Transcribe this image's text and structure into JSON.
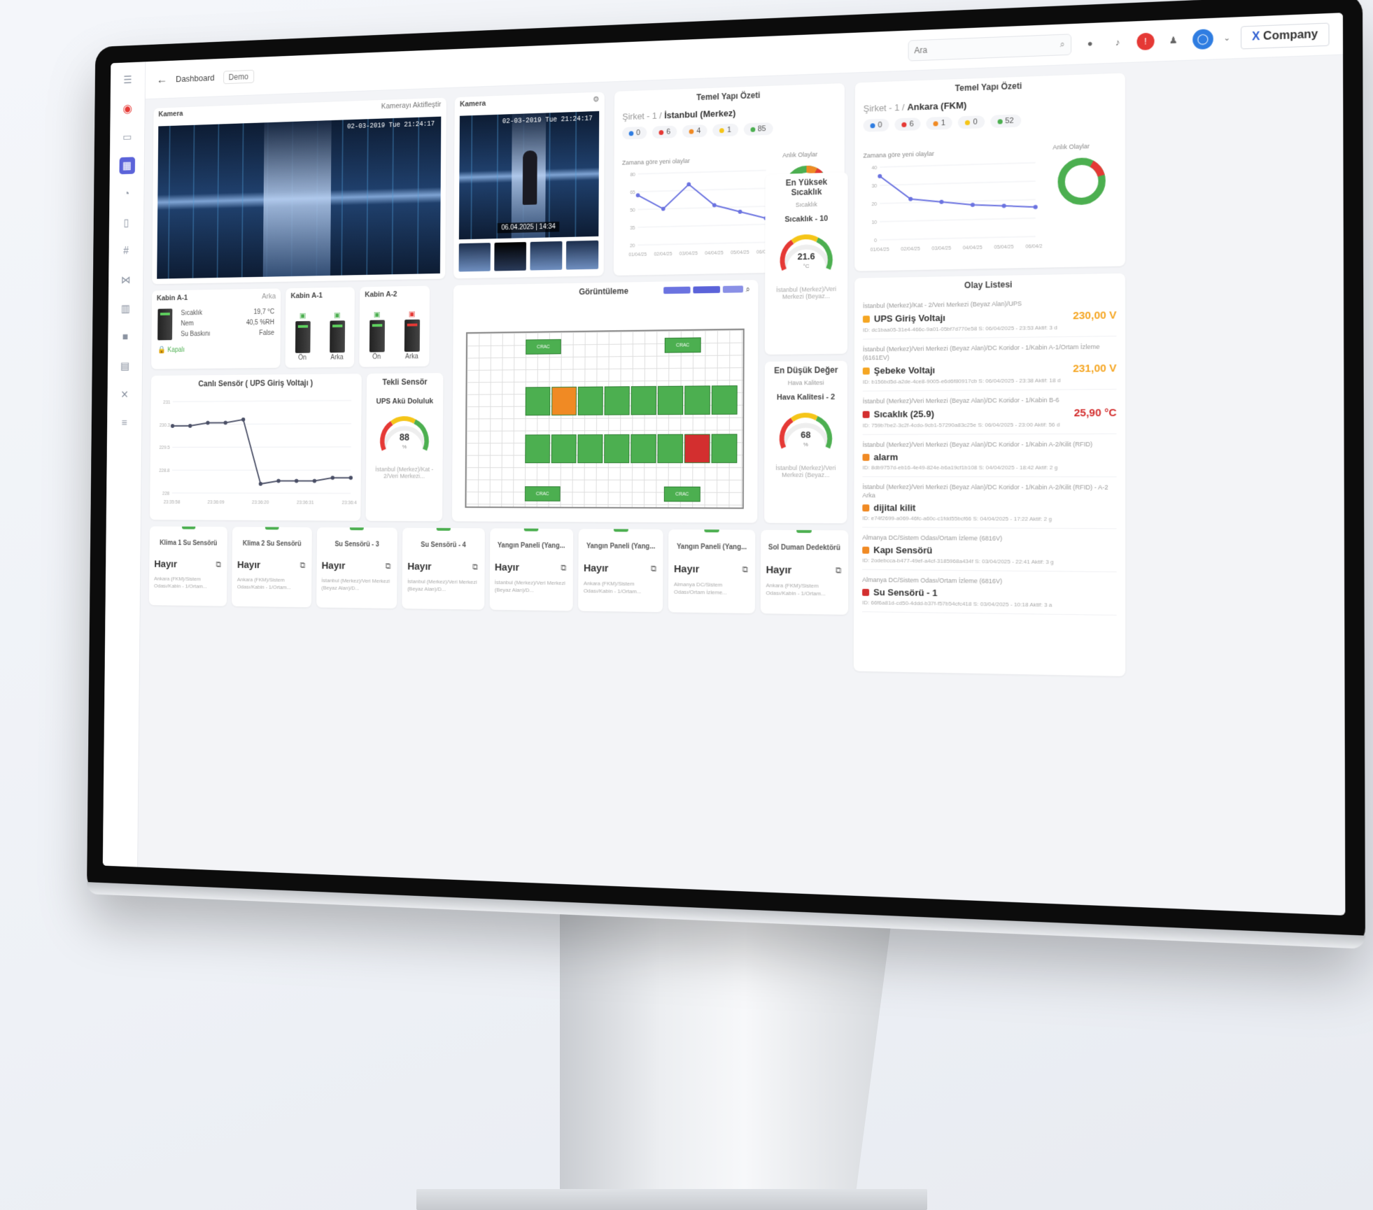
{
  "topbar": {
    "crumb": "Dashboard",
    "demo": "Demo",
    "search_placeholder": "Ara",
    "company_x": "X",
    "company_name": "Company"
  },
  "camera_main": {
    "title": "Kamera",
    "action": "Kamerayı Aktifleştir",
    "stamp": "02-03-2019 Tue 21:24:17"
  },
  "camera_side": {
    "title": "Kamera",
    "stamp": "02-03-2019 Tue 21:24:17",
    "date": "06.04.2025 | 14:34"
  },
  "summary1": {
    "title": "Temel Yapı Özeti",
    "path_light": "Şirket - 1 /",
    "path_bold": "İstanbul (Merkez)",
    "pills": [
      "0",
      "6",
      "4",
      "1",
      "85"
    ],
    "pill_colors": [
      "#2f7de1",
      "#e53935",
      "#f08a24",
      "#f5c518",
      "#4caf50"
    ],
    "line_label": "Zamana göre yeni olaylar",
    "donut_label": "Anlık Olaylar"
  },
  "summary2": {
    "title": "Temel Yapı Özeti",
    "path_light": "Şirket - 1 /",
    "path_bold": "Ankara (FKM)",
    "pills": [
      "0",
      "6",
      "1",
      "0",
      "52"
    ],
    "pill_colors": [
      "#2f7de1",
      "#e53935",
      "#f08a24",
      "#f5c518",
      "#4caf50"
    ],
    "line_label": "Zamana göre yeni olaylar",
    "donut_label": "Anlık Olaylar"
  },
  "cabinets": {
    "a1": {
      "title": "Kabin A-1",
      "side": "Arka",
      "labels": [
        "Sıcaklık",
        "Nem",
        "Su Baskını"
      ],
      "values": [
        "19,7 °C",
        "40,5 %RH",
        "False"
      ],
      "state": "Kapalı"
    },
    "a1b": {
      "title": "Kabin A-1",
      "front": "Ön",
      "back": "Arka"
    },
    "a2": {
      "title": "Kabin A-2",
      "front": "Ön",
      "back": "Arka"
    }
  },
  "live": {
    "title": "Canlı Sensör ( UPS Giriş Voltajı )"
  },
  "single": {
    "title": "Tekli Sensör",
    "gauge_title": "UPS Akü Doluluk",
    "value": "88",
    "unit": "%",
    "loc": "İstanbul (Merkez)/Kat - 2/Veri Merkezi..."
  },
  "view": {
    "title": "Görüntüleme"
  },
  "highest": {
    "title": "En Yüksek Sıcaklık",
    "sub": "Sıcaklık",
    "gauge_title": "Sıcaklık - 10",
    "value": "21.6",
    "unit": "°C",
    "loc": "İstanbul (Merkez)/Veri Merkezi (Beyaz..."
  },
  "lowest": {
    "title": "En Düşük Değer",
    "sub": "Hava Kalitesi",
    "gauge_title": "Hava Kalitesi - 2",
    "value": "68",
    "unit": "%",
    "loc": "İstanbul (Merkez)/Veri Merkezi (Beyaz..."
  },
  "events": {
    "title": "Olay Listesi",
    "items": [
      {
        "loc": "İstanbul (Merkez)/Kat - 2/Veri Merkezi (Beyaz Alan)/UPS",
        "name": "UPS Giriş Voltajı",
        "value": "230,00 V",
        "color": "#f5a623",
        "meta": "ID: dc1baa05-31e4-466c-9a01-05bf7d770e58   S: 06/04/2025 - 23:53   Aktif: 3 d"
      },
      {
        "loc": "İstanbul (Merkez)/Veri Merkezi (Beyaz Alan)/DC Koridor - 1/Kabin A-1/Ortam İzleme (6161EV)",
        "name": "Şebeke Voltajı",
        "value": "231,00 V",
        "color": "#f5a623",
        "meta": "ID: b156bd5d-a2de-4ce8-9005-e6d6f80917cb   S: 06/04/2025 - 23:38   Aktif: 18 d"
      },
      {
        "loc": "İstanbul (Merkez)/Veri Merkezi (Beyaz Alan)/DC Koridor - 1/Kabin B-6",
        "name": "Sıcaklık (25.9)",
        "value": "25,90 °C",
        "color": "#d32f2f",
        "meta": "ID: 759b7be2-3c2f-4cdo-9cb1-57290a83c25e   S: 06/04/2025 - 23:00   Aktif: 56 d"
      },
      {
        "loc": "İstanbul (Merkez)/Veri Merkezi (Beyaz Alan)/DC Koridor - 1/Kabin A-2/Kilit (RFID)",
        "name": "alarm",
        "value": "",
        "color": "#f08a24",
        "meta": "ID: 8db9757d-eb16-4e49-824e-b6a19cf1b108   S: 04/04/2025 - 18:42   Aktif: 2 g"
      },
      {
        "loc": "İstanbul (Merkez)/Veri Merkezi (Beyaz Alan)/DC Koridor - 1/Kabin A-2/Kilit (RFID) - A-2 Arka",
        "name": "dijital kilit",
        "value": "",
        "color": "#f08a24",
        "meta": "ID: e74f2699-a069-46fc-a60c-c1fdd55bcf66   S: 04/04/2025 - 17:22   Aktif: 2 g"
      },
      {
        "loc": "Almanya DC/Sistem Odası/Ortam İzleme (6816V)",
        "name": "Kapı Sensörü",
        "value": "",
        "color": "#f08a24",
        "meta": "ID: 2odebcca-b477-49ef-a4cf-3185968a434f   S: 03/04/2025 - 22:41   Aktif: 3 g"
      },
      {
        "loc": "Almanya DC/Sistem Odası/Ortam İzleme (6816V)",
        "name": "Su Sensörü - 1",
        "value": "",
        "color": "#d32f2f",
        "meta": "ID: 66f6a81d-cd50-4ddd-b37f-f57b54cfc418   S: 03/04/2025 - 10:18   Aktif: 3 a"
      }
    ]
  },
  "sensors": [
    {
      "title": "Klima 1 Su Sensörü",
      "value": "Hayır",
      "loc": "Ankara (FKM)/Sistem Odası/Kabin - 1/Ortam..."
    },
    {
      "title": "Klima 2 Su Sensörü",
      "value": "Hayır",
      "loc": "Ankara (FKM)/Sistem Odası/Kabin - 1/Ortam..."
    },
    {
      "title": "Su Sensörü - 3",
      "value": "Hayır",
      "loc": "İstanbul (Merkez)/Veri Merkezi (Beyaz Alan)/D..."
    },
    {
      "title": "Su Sensörü - 4",
      "value": "Hayır",
      "loc": "İstanbul (Merkez)/Veri Merkezi (Beyaz Alan)/D..."
    },
    {
      "title": "Yangın Paneli (Yang...",
      "value": "Hayır",
      "loc": "İstanbul (Merkez)/Veri Merkezi (Beyaz Alan)/D..."
    },
    {
      "title": "Yangın Paneli (Yang...",
      "value": "Hayır",
      "loc": "Ankara (FKM)/Sistem Odası/Kabin - 1/Ortam..."
    },
    {
      "title": "Yangın Paneli (Yang...",
      "value": "Hayır",
      "loc": "Almanya DC/Sistem Odası/Ortam İzleme..."
    },
    {
      "title": "Sol Duman Dedektörü",
      "value": "Hayır",
      "loc": "Ankara (FKM)/Sistem Odası/Kabin - 1/Ortam..."
    }
  ],
  "chart_data": [
    {
      "type": "line",
      "title": "",
      "x": [
        "01/04/25",
        "02/04/25",
        "03/04/25",
        "04/04/25",
        "05/04/25",
        "06/04/25"
      ],
      "series": [
        {
          "values": [
            62,
            50,
            70,
            52,
            46,
            40
          ]
        }
      ],
      "ylim": [
        20,
        80
      ]
    },
    {
      "type": "line",
      "title": "",
      "x": [
        "01/04/25",
        "02/04/25",
        "03/04/25",
        "04/04/25",
        "05/04/25",
        "06/04/25"
      ],
      "series": [
        {
          "values": [
            35,
            22,
            20,
            18,
            17,
            16
          ]
        }
      ],
      "ylim": [
        0,
        40
      ]
    },
    {
      "type": "line",
      "title": "Canlı Sensör ( UPS Giriş Voltajı )",
      "x": [
        "23:35:58",
        "23:36:09",
        "23:36:20",
        "23:36:31",
        "23:36:42"
      ],
      "series": [
        {
          "values": [
            230.2,
            230.2,
            230.3,
            230.3,
            230.4,
            228.3,
            228.4,
            228.4,
            228.4,
            228.5,
            228.5
          ]
        }
      ],
      "ylim": [
        228,
        231
      ]
    }
  ]
}
